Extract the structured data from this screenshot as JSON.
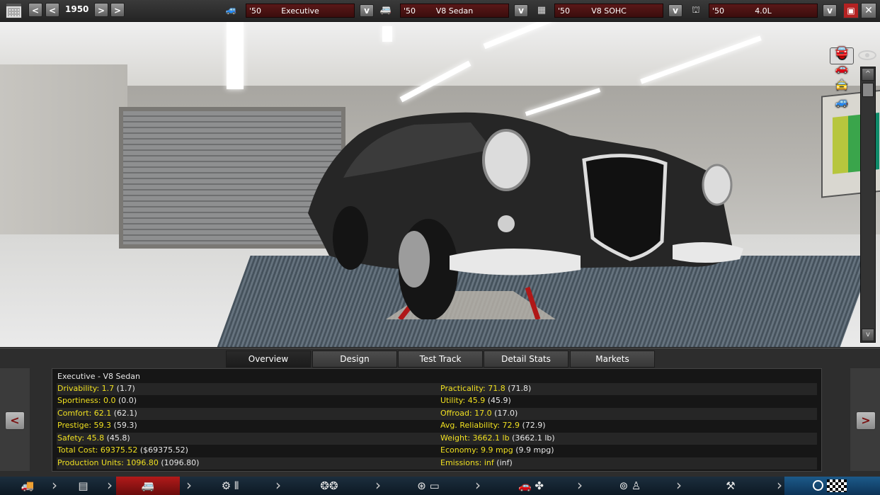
{
  "topbar": {
    "year": "1950",
    "selectors": [
      {
        "year": "'50",
        "name": "Executive",
        "icon": "car-model-icon"
      },
      {
        "year": "'50",
        "name": "V8 Sedan",
        "icon": "car-trim-icon"
      },
      {
        "year": "'50",
        "name": "V8 SOHC",
        "icon": "engine-family-icon"
      },
      {
        "year": "'50",
        "name": "4.0L",
        "icon": "engine-variant-icon"
      }
    ],
    "dropdown_glyph": "v"
  },
  "tabs": [
    "Overview",
    "Design",
    "Test Track",
    "Detail Stats",
    "Markets"
  ],
  "active_tab": "Overview",
  "overview": {
    "title": "Executive - V8 Sedan",
    "left": [
      {
        "label": "Drivability: 1.7",
        "extra": "(1.7)"
      },
      {
        "label": "Sportiness: 0.0",
        "extra": "(0.0)"
      },
      {
        "label": "Comfort: 62.1",
        "extra": "(62.1)"
      },
      {
        "label": "Prestige: 59.3",
        "extra": "(59.3)"
      },
      {
        "label": "Safety: 45.8",
        "extra": "(45.8)"
      },
      {
        "label": "Total Cost: 69375.52",
        "extra": "($69375.52)"
      },
      {
        "label": "Production Units: 1096.80",
        "extra": "(1096.80)"
      }
    ],
    "right": [
      {
        "label": "Practicality: 71.8",
        "extra": "(71.8)"
      },
      {
        "label": "Utility: 45.9",
        "extra": "(45.9)"
      },
      {
        "label": "Offroad: 17.0",
        "extra": "(17.0)"
      },
      {
        "label": "Avg. Reliability: 72.9",
        "extra": "(72.9)"
      },
      {
        "label": "Weight: 3662.1 lb",
        "extra": "(3662.1 lb)"
      },
      {
        "label": "Economy: 9.9 mpg",
        "extra": "(9.9 mpg)"
      },
      {
        "label": "Emissions: inf",
        "extra": "(inf)"
      }
    ]
  },
  "colors": {
    "accent_red": "#b21a1a",
    "stat_yellow": "#f0e020"
  }
}
